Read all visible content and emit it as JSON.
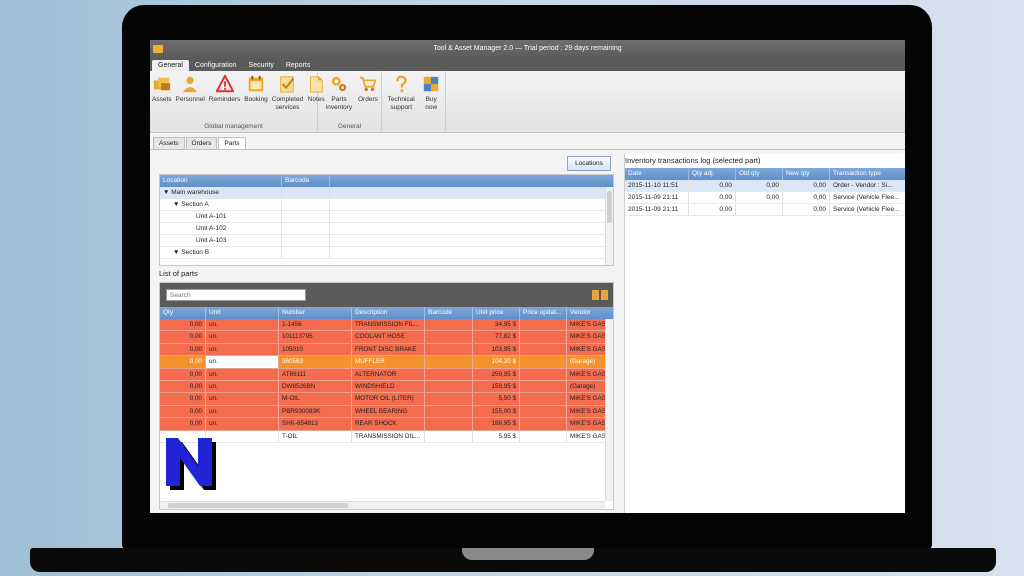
{
  "window": {
    "title": "Tool & Asset Manager 2.0 — Trial period : 29 days remaining"
  },
  "ribbon_tabs": [
    "General",
    "Configuration",
    "Security",
    "Reports"
  ],
  "ribbon_groups": {
    "global": {
      "label": "Global management",
      "buttons": [
        {
          "label": "Assets",
          "icon": "assets-icon"
        },
        {
          "label": "Personnel",
          "icon": "personnel-icon"
        },
        {
          "label": "Reminders",
          "icon": "warning-icon"
        },
        {
          "label": "Booking",
          "icon": "booking-icon"
        },
        {
          "label": "Completed services",
          "icon": "checklist-icon"
        },
        {
          "label": "Notes",
          "icon": "note-icon"
        }
      ]
    },
    "general": {
      "label": "General",
      "buttons": [
        {
          "label": "Parts inventory",
          "icon": "gears-icon"
        },
        {
          "label": "Orders",
          "icon": "cart-icon"
        }
      ]
    },
    "extra": {
      "buttons": [
        {
          "label": "Technical support",
          "icon": "question-icon"
        },
        {
          "label": "Buy now",
          "icon": "buy-icon"
        }
      ]
    }
  },
  "sub_tabs": [
    "Assets",
    "Orders",
    "Parts"
  ],
  "locations_button": "Locations",
  "location_tree": {
    "headers": [
      "Location",
      "Barcode"
    ],
    "rows": [
      {
        "label": "▼ Main warehouse",
        "indent": 0
      },
      {
        "label": "▼ Section A",
        "indent": 1
      },
      {
        "label": "Unit A-101",
        "indent": 2
      },
      {
        "label": "Unit A-102",
        "indent": 2
      },
      {
        "label": "Unit A-103",
        "indent": 2
      },
      {
        "label": "▼ Section B",
        "indent": 1
      }
    ]
  },
  "parts": {
    "label": "List of parts",
    "search_placeholder": "Search",
    "headers": [
      "Qty",
      "Unit",
      "Number",
      "Description",
      "Barcode",
      "Unit price",
      "Price updat...",
      "Vendor"
    ],
    "rows": [
      {
        "qty": "0,00",
        "unit": "un.",
        "number": "1-1456",
        "desc": "TRANSMISSION FIL...",
        "barcode": "",
        "price": "34,95 $",
        "upd": "",
        "vendor": "MIKE'S GAS",
        "style": "red"
      },
      {
        "qty": "0,00",
        "unit": "un.",
        "number": "101113795",
        "desc": "COOLANT HOSE",
        "barcode": "",
        "price": "77,82 $",
        "upd": "",
        "vendor": "MIKE'S GAS",
        "style": "red"
      },
      {
        "qty": "0,00",
        "unit": "un.",
        "number": "105010",
        "desc": "FRONT DISC BRAKE",
        "barcode": "",
        "price": "103,95 $",
        "upd": "",
        "vendor": "MIKE'S GAS",
        "style": "red"
      },
      {
        "qty": "0,00",
        "unit": "un.",
        "number": "360563",
        "desc": "MUFFLER",
        "barcode": "",
        "price": "104,20 $",
        "upd": "",
        "vendor": "(Garage)",
        "style": "orange"
      },
      {
        "qty": "0,00",
        "unit": "un.",
        "number": "AT86111",
        "desc": "ALTERNATOR",
        "barcode": "",
        "price": "259,95 $",
        "upd": "",
        "vendor": "MIKE'S GAS",
        "style": "red"
      },
      {
        "qty": "0,00",
        "unit": "un.",
        "number": "DW8526BN",
        "desc": "WINDSHIELD",
        "barcode": "",
        "price": "159,95 $",
        "upd": "",
        "vendor": "(Garage)",
        "style": "red"
      },
      {
        "qty": "0,00",
        "unit": "un.",
        "number": "M-OIL",
        "desc": "MOTOR OIL (LITER)",
        "barcode": "",
        "price": "5,50 $",
        "upd": "",
        "vendor": "MIKE'S GAS",
        "style": "red"
      },
      {
        "qty": "0,00",
        "unit": "un.",
        "number": "PBR930083K",
        "desc": "WHEEL BEARING",
        "barcode": "",
        "price": "155,00 $",
        "upd": "",
        "vendor": "MIKE'S GAS",
        "style": "red"
      },
      {
        "qty": "0,00",
        "unit": "un.",
        "number": "SHK-654813",
        "desc": "REAR SHOCK",
        "barcode": "",
        "price": "188,95 $",
        "upd": "",
        "vendor": "MIKE'S GAS",
        "style": "red"
      },
      {
        "qty": "",
        "unit": "",
        "number": "T-OIL",
        "desc": "TRANSMISSION OIL...",
        "barcode": "",
        "price": "5,95 $",
        "upd": "",
        "vendor": "MIKE'S GAS",
        "style": "white"
      }
    ]
  },
  "log": {
    "label": "Inventory transactions log (selected part)",
    "headers": [
      "Date",
      "Qty adj.",
      "Old qty",
      "New qty",
      "Transaction type"
    ],
    "rows": [
      {
        "date": "2015-11-10 11:51",
        "adj": "0,00",
        "old": "0,00",
        "new": "0,00",
        "type": "Order - Vendor : Si...",
        "sel": true
      },
      {
        "date": "2015-11-09 21:11",
        "adj": "0,00",
        "old": "0,00",
        "new": "0,00",
        "type": "Service (Vehicle Flee...",
        "sel": false
      },
      {
        "date": "2015-11-09 21:11",
        "adj": "0,00",
        "old": "",
        "new": "0,00",
        "type": "Service (Vehicle Flee...",
        "sel": false
      }
    ]
  },
  "colors": {
    "critical_row": "#f46b4e",
    "selected_row": "#f5922b",
    "header_blue": "#6e9ad2",
    "logo_blue": "#2323d6"
  }
}
